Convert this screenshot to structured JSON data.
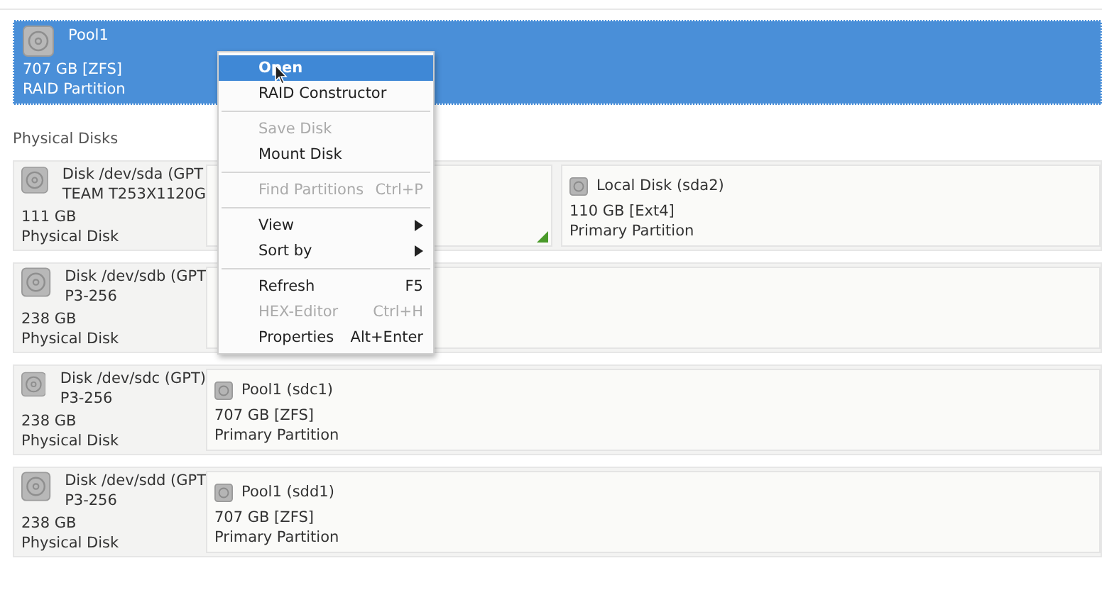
{
  "pool": {
    "name": "Pool1",
    "size": "707 GB [ZFS]",
    "type": "RAID Partition",
    "selected": true
  },
  "section_title": "Physical Disks",
  "disks": [
    {
      "name": "Disk /dev/sda (GPT",
      "model": "TEAM T253X1120G",
      "size": "111 GB",
      "type": "Physical Disk",
      "partitions": [
        {
          "kind": "covered",
          "marker": true
        },
        {
          "kind": "partition",
          "name": "Local Disk (sda2)",
          "size": "110 GB [Ext4]",
          "type": "Primary Partition",
          "marker": false
        }
      ]
    },
    {
      "name": "Disk /dev/sdb (GPT",
      "model": "P3-256",
      "size": "238 GB",
      "type": "Physical Disk",
      "partitions": [
        {
          "kind": "covered",
          "marker": false
        }
      ]
    },
    {
      "name": "Disk /dev/sdc (GPT)",
      "model": "P3-256",
      "size": "238 GB",
      "type": "Physical Disk",
      "partitions": [
        {
          "kind": "partition",
          "name": "Pool1 (sdc1)",
          "size": "707 GB [ZFS]",
          "type": "Primary Partition",
          "marker": false
        }
      ]
    },
    {
      "name": "Disk /dev/sdd (GPT",
      "model": "P3-256",
      "size": "238 GB",
      "type": "Physical Disk",
      "partitions": [
        {
          "kind": "partition",
          "name": "Pool1 (sdd1)",
          "size": "707 GB [ZFS]",
          "type": "Primary Partition",
          "marker": false
        }
      ]
    }
  ],
  "context_menu": [
    {
      "kind": "item",
      "label": "Open",
      "selected": true,
      "disabled": false
    },
    {
      "kind": "item",
      "label": "RAID Constructor",
      "selected": false,
      "disabled": false
    },
    {
      "kind": "separator"
    },
    {
      "kind": "item",
      "label": "Save Disk",
      "selected": false,
      "disabled": true
    },
    {
      "kind": "item",
      "label": "Mount Disk",
      "selected": false,
      "disabled": false
    },
    {
      "kind": "separator"
    },
    {
      "kind": "item",
      "label": "Find Partitions",
      "shortcut": "Ctrl+P",
      "selected": false,
      "disabled": true
    },
    {
      "kind": "separator"
    },
    {
      "kind": "item",
      "label": "View",
      "submenu": true,
      "selected": false,
      "disabled": false
    },
    {
      "kind": "item",
      "label": "Sort by",
      "submenu": true,
      "selected": false,
      "disabled": false
    },
    {
      "kind": "separator"
    },
    {
      "kind": "item",
      "label": "Refresh",
      "shortcut": "F5",
      "selected": false,
      "disabled": false
    },
    {
      "kind": "item",
      "label": "HEX-Editor",
      "shortcut": "Ctrl+H",
      "selected": false,
      "disabled": true
    },
    {
      "kind": "item",
      "label": "Properties",
      "shortcut": "Alt+Enter",
      "selected": false,
      "disabled": false
    }
  ]
}
